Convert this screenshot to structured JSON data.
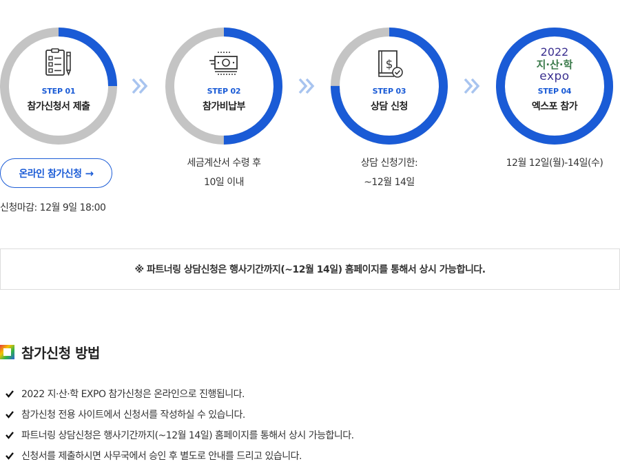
{
  "steps": [
    {
      "num": "STEP 01",
      "title": "참가신청서 제출",
      "icon": "checklist-icon",
      "progress": 0.25
    },
    {
      "num": "STEP 02",
      "title": "참가비납부",
      "icon": "money-icon",
      "progress": 0.5,
      "desc": [
        "세금계산서 수령 후",
        "10일 이내"
      ]
    },
    {
      "num": "STEP 03",
      "title": "상담 신청",
      "icon": "dollar-book-check-icon",
      "progress": 0.75,
      "desc": [
        "상담 신청기한:",
        "~12월 14일"
      ]
    },
    {
      "num": "STEP 04",
      "title": "엑스포 참가",
      "icon": "expo-logo",
      "progress": 1.0,
      "desc": [
        "12월 12일(월)-14일(수)"
      ]
    }
  ],
  "logo": {
    "year": "2022",
    "name": "지·산·학",
    "expo": "expo"
  },
  "apply_button": {
    "label": "온라인 참가신청",
    "arrow": "→"
  },
  "deadline": "신청마감: 12월 9일 18:00",
  "notice": "※ 파트너링 상담신청은 행사기간까지(~12월 14일) 홈페이지를 통해서 상시 가능합니다.",
  "section": {
    "title": "참가신청 방법"
  },
  "list": [
    "2022 지·산·학 EXPO 참가신청은 온라인으로 진행됩니다.",
    "참가신청 전용 사이트에서 신청서를 작성하실 수 있습니다.",
    "파트너링 상담신청은 행사기간까지(~12월 14일) 홈페이지를 통해서 상시 가능합니다.",
    "신청서를 제출하시면 사무국에서 승인 후 별도로 안내를 드리고 있습니다."
  ],
  "colors": {
    "accent": "#1a5bd6",
    "ring_track": "#c4c4c4",
    "arrow": "#a8c4ef"
  }
}
